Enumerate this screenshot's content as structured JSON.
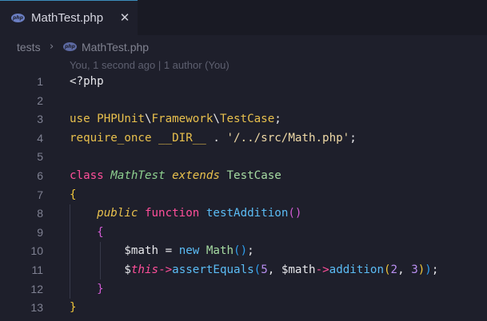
{
  "tab": {
    "badge": "php",
    "title": "MathTest.php",
    "close": "✕"
  },
  "breadcrumb": {
    "folder": "tests",
    "separator": "›",
    "badge": "php",
    "file": "MathTest.php"
  },
  "codelens": "You, 1 second ago | 1 author (You)",
  "colors": {
    "background": "#1e1f2b",
    "keyword": "#e8c04d",
    "function": "#5bbcf5",
    "storage": "#ff4f9a",
    "number": "#b98ef0"
  },
  "code": {
    "lines": [
      {
        "num": "1",
        "tokens": [
          {
            "t": "<?php",
            "c": "t-plain"
          }
        ]
      },
      {
        "num": "2",
        "tokens": []
      },
      {
        "num": "3",
        "tokens": [
          {
            "t": "use ",
            "c": "t-kw"
          },
          {
            "t": "PHPUnit",
            "c": "t-kw"
          },
          {
            "t": "\\",
            "c": "t-plain"
          },
          {
            "t": "Framework",
            "c": "t-kw"
          },
          {
            "t": "\\",
            "c": "t-plain"
          },
          {
            "t": "TestCase",
            "c": "t-kw"
          },
          {
            "t": ";",
            "c": "t-plain"
          }
        ]
      },
      {
        "num": "4",
        "tokens": [
          {
            "t": "require_once ",
            "c": "t-kw"
          },
          {
            "t": "__DIR__",
            "c": "t-kw"
          },
          {
            "t": " . ",
            "c": "t-plain"
          },
          {
            "t": "'/../src/Math.php'",
            "c": "t-str"
          },
          {
            "t": ";",
            "c": "t-plain"
          }
        ]
      },
      {
        "num": "5",
        "tokens": []
      },
      {
        "num": "6",
        "tokens": [
          {
            "t": "class ",
            "c": "t-pink"
          },
          {
            "t": "MathTest",
            "c": "t-cls-it"
          },
          {
            "t": " ",
            "c": "t-plain"
          },
          {
            "t": "extends",
            "c": "t-kw2"
          },
          {
            "t": " ",
            "c": "t-plain"
          },
          {
            "t": "TestCase",
            "c": "t-class"
          }
        ]
      },
      {
        "num": "7",
        "tokens": [
          {
            "t": "{",
            "c": "t-brace1"
          }
        ]
      },
      {
        "num": "8",
        "tokens": [
          {
            "t": "    ",
            "c": "t-plain"
          },
          {
            "t": "public",
            "c": "t-kw2"
          },
          {
            "t": " ",
            "c": "t-plain"
          },
          {
            "t": "function",
            "c": "t-pink"
          },
          {
            "t": " ",
            "c": "t-plain"
          },
          {
            "t": "testAddition",
            "c": "t-func"
          },
          {
            "t": "()",
            "c": "t-brace2"
          }
        ]
      },
      {
        "num": "9",
        "tokens": [
          {
            "t": "    ",
            "c": "t-plain"
          },
          {
            "t": "{",
            "c": "t-brace2"
          }
        ]
      },
      {
        "num": "10",
        "tokens": [
          {
            "t": "        ",
            "c": "t-plain"
          },
          {
            "t": "$math",
            "c": "t-var"
          },
          {
            "t": " = ",
            "c": "t-plain"
          },
          {
            "t": "new",
            "c": "t-func"
          },
          {
            "t": " ",
            "c": "t-plain"
          },
          {
            "t": "Math",
            "c": "t-class"
          },
          {
            "t": "()",
            "c": "t-brace3"
          },
          {
            "t": ";",
            "c": "t-plain"
          }
        ]
      },
      {
        "num": "11",
        "tokens": [
          {
            "t": "        ",
            "c": "t-plain"
          },
          {
            "t": "$",
            "c": "t-var"
          },
          {
            "t": "this",
            "c": "t-this"
          },
          {
            "t": "->",
            "c": "t-arrow"
          },
          {
            "t": "assertEquals",
            "c": "t-func"
          },
          {
            "t": "(",
            "c": "t-brace3"
          },
          {
            "t": "5",
            "c": "t-num"
          },
          {
            "t": ", ",
            "c": "t-plain"
          },
          {
            "t": "$math",
            "c": "t-var"
          },
          {
            "t": "->",
            "c": "t-arrow"
          },
          {
            "t": "addition",
            "c": "t-func"
          },
          {
            "t": "(",
            "c": "t-brace1"
          },
          {
            "t": "2",
            "c": "t-num"
          },
          {
            "t": ", ",
            "c": "t-plain"
          },
          {
            "t": "3",
            "c": "t-num"
          },
          {
            "t": ")",
            "c": "t-brace1"
          },
          {
            "t": ")",
            "c": "t-brace3"
          },
          {
            "t": ";",
            "c": "t-plain"
          }
        ]
      },
      {
        "num": "12",
        "tokens": [
          {
            "t": "    ",
            "c": "t-plain"
          },
          {
            "t": "}",
            "c": "t-brace2"
          }
        ]
      },
      {
        "num": "13",
        "tokens": [
          {
            "t": "}",
            "c": "t-brace1"
          }
        ]
      }
    ]
  }
}
